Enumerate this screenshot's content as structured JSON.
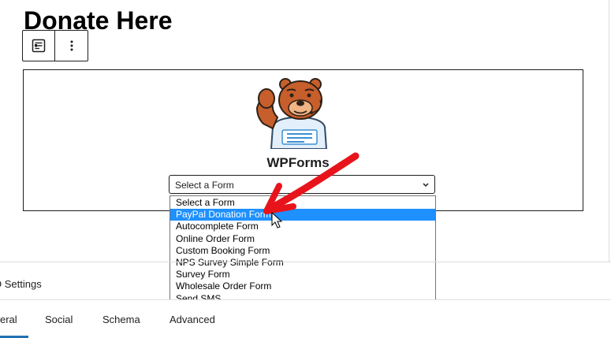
{
  "page": {
    "title": "Donate Here"
  },
  "toolbar": {
    "block_icon": "form-icon",
    "more_icon": "more-vertical-icon"
  },
  "block": {
    "brand": "WPForms",
    "mascot_icon": "wpforms-bear-icon",
    "select": {
      "value": "Select a Form",
      "icon": "chevron-down-icon"
    },
    "options": [
      "Select a Form",
      "PayPal Donation Form",
      "Autocomplete Form",
      "Online Order Form",
      "Custom Booking Form",
      "NPS Survey Simple Form",
      "Survey Form",
      "Wholesale Order Form",
      "Send SMS"
    ],
    "selected_option": "PayPal Donation Form"
  },
  "panel": {
    "settings_label": "O Settings",
    "tabs": [
      "eral",
      "Social",
      "Schema",
      "Advanced"
    ],
    "active_tab": "eral"
  },
  "colors": {
    "highlight": "#1e90ff",
    "annotation_arrow": "#e8141b",
    "tab_accent": "#2271b1"
  }
}
